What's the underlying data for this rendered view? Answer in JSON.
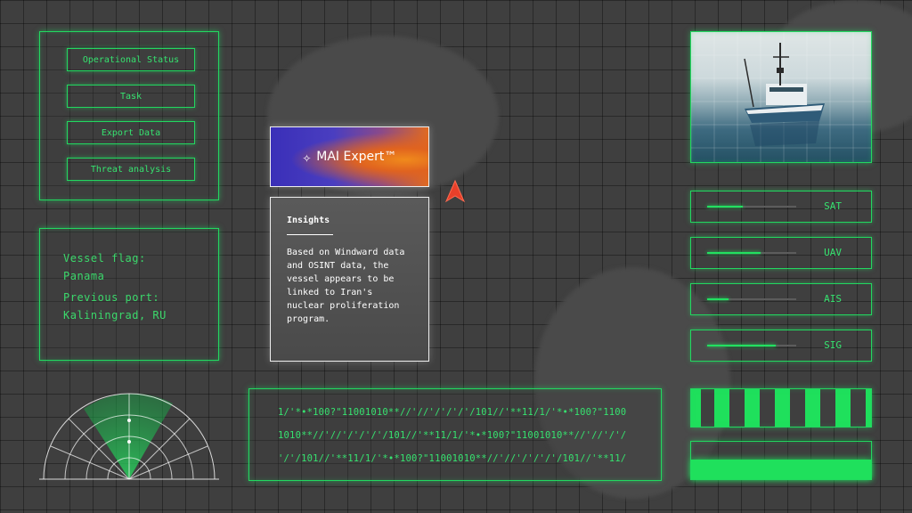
{
  "menu": {
    "items": [
      {
        "label": "Operational Status"
      },
      {
        "label": "Task"
      },
      {
        "label": "Export Data"
      },
      {
        "label": "Threat analysis"
      }
    ]
  },
  "vessel": {
    "flag_label": "Vessel flag:",
    "flag_value": "Panama",
    "port_label": "Previous port:",
    "port_value": "Kaliningrad, RU"
  },
  "mai": {
    "title": "MAI Expert™"
  },
  "insights": {
    "heading": "Insights",
    "body": "Based on Windward data and OSINT data, the vessel appears to be linked to Iran's nuclear proliferation program."
  },
  "signals": [
    {
      "label": "SAT",
      "level": 0.4
    },
    {
      "label": "UAV",
      "level": 0.6
    },
    {
      "label": "AIS",
      "level": 0.24
    },
    {
      "label": "SIG",
      "level": 0.77
    }
  ],
  "datastream": {
    "lines": [
      "1/'*•*100?\"11001010**//'//'/'/'/'/101//'**11/1/'*•*100?\"1100",
      "1010**//'//'/'/'/'/101//'**11/1/'*•*100?\"11001010**//'//'/'/",
      "'/'/101//'**11/1/'*•*100?\"11001010**//'//'/'/'/'/101//'**11/"
    ]
  },
  "colors": {
    "accent": "#22d860",
    "background": "#3f3f3f"
  }
}
